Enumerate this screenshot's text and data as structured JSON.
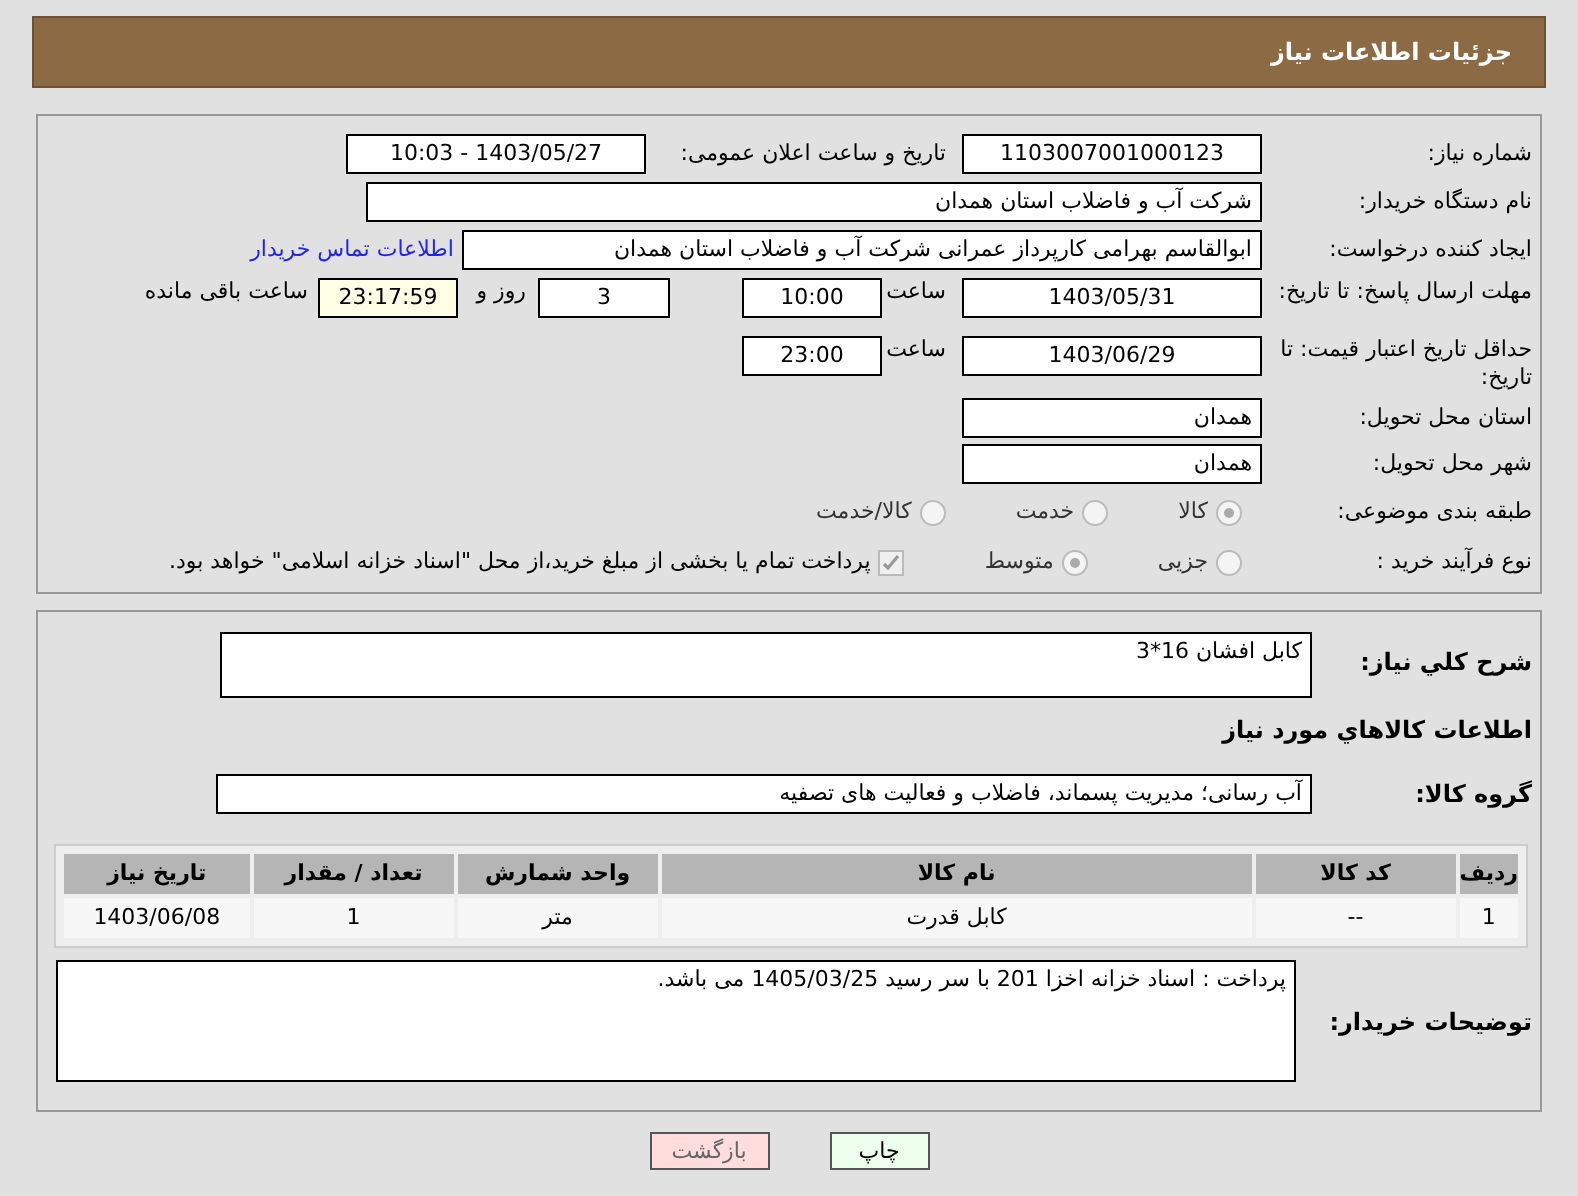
{
  "header": {
    "title": "جزئیات اطلاعات نیاز"
  },
  "need_number": {
    "label": "شماره نیاز:",
    "value": "1103007001000123"
  },
  "announce": {
    "label": "تاریخ و ساعت اعلان عمومی:",
    "value": "1403/05/27 - 10:03"
  },
  "buyer_org": {
    "label": "نام دستگاه خریدار:",
    "value": "شرکت آب و فاضلاب استان همدان"
  },
  "requester": {
    "label": "ایجاد کننده درخواست:",
    "value": "ابوالقاسم بهرامی کارپرداز عمرانی شرکت آب و فاضلاب استان همدان",
    "link": "اطلاعات تماس خریدار"
  },
  "reply_deadline": {
    "label": "مهلت ارسال پاسخ: تا تاریخ:",
    "date": "1403/05/31",
    "time_label": "ساعت",
    "time": "10:00",
    "days": "3",
    "days_label": "روز و",
    "remaining": "23:17:59",
    "remaining_label": "ساعت باقی مانده"
  },
  "price_validity": {
    "label": "حداقل تاریخ اعتبار قیمت: تا تاریخ:",
    "date": "1403/06/29",
    "time_label": "ساعت",
    "time": "23:00"
  },
  "province": {
    "label": "استان محل تحویل:",
    "value": "همدان"
  },
  "city": {
    "label": "شهر محل تحویل:",
    "value": "همدان"
  },
  "category": {
    "label": "طبقه بندی موضوعی:",
    "options": [
      {
        "label": "کالا",
        "selected": true
      },
      {
        "label": "خدمت",
        "selected": false
      },
      {
        "label": "کالا/خدمت",
        "selected": false
      }
    ]
  },
  "process": {
    "label": "نوع فرآیند خرید :",
    "options": [
      {
        "label": "جزیی",
        "selected": false
      },
      {
        "label": "متوسط",
        "selected": true
      }
    ],
    "treasury": {
      "label": "پرداخت تمام یا بخشی از مبلغ خرید،از محل \"اسناد خزانه اسلامی\" خواهد بود.",
      "checked": true
    }
  },
  "description": {
    "label": "شرح کلي نياز:",
    "value": "کابل افشان 16*3"
  },
  "goods_title": "اطلاعات کالاهاي مورد نياز",
  "goods_group": {
    "label": "گروه کالا:",
    "value": "آب رسانی؛ مدیریت پسماند، فاضلاب و فعالیت های تصفیه"
  },
  "table": {
    "columns": [
      "ردیف",
      "کد کالا",
      "نام کالا",
      "واحد شمارش",
      "تعداد / مقدار",
      "تاریخ نیاز"
    ],
    "rows": [
      [
        "1",
        "--",
        "کابل قدرت",
        "متر",
        "1",
        "1403/06/08"
      ]
    ]
  },
  "buyer_notes": {
    "label": "توضیحات خریدار:",
    "value": "پرداخت : اسناد خزانه اخزا 201 با سر رسید 1405/03/25 می باشد."
  },
  "buttons": [
    {
      "label": "چاپ",
      "kind": "print"
    },
    {
      "label": "بازگشت",
      "kind": "back"
    }
  ]
}
